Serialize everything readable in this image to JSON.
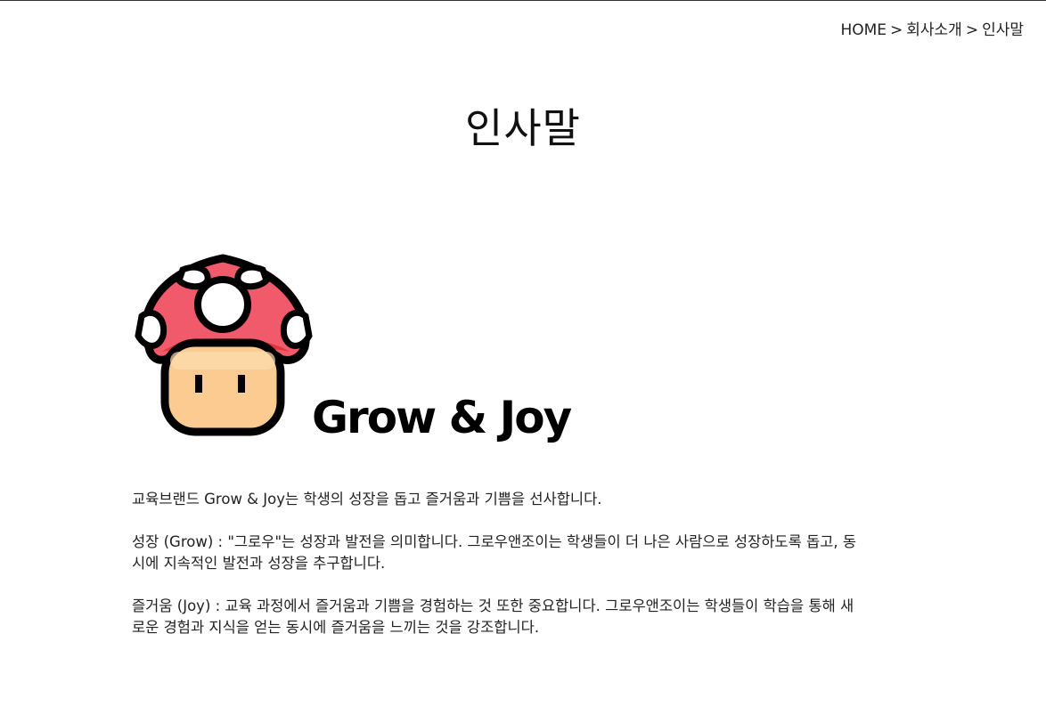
{
  "breadcrumb": {
    "home": "HOME",
    "separator": ">",
    "section": "회사소개",
    "current": "인사말"
  },
  "page": {
    "title": "인사말"
  },
  "logo": {
    "brand_text": "Grow & Joy",
    "icon": "mushroom-icon",
    "colors": {
      "cap": "#F05A6A",
      "cap_shadow": "#E2363F",
      "spots": "#FFFFFF",
      "face": "#FCCB92",
      "outline": "#000000"
    }
  },
  "content": {
    "intro": "교육브랜드 Grow & Joy는 학생의 성장을 돕고 즐거움과 기쁨을 선사합니다.",
    "grow": "성장 (Grow) : \"그로우\"는 성장과 발전을 의미합니다. 그로우앤조이는 학생들이 더 나은 사람으로 성장하도록 돕고, 동시에 지속적인 발전과 성장을 추구합니다.",
    "joy": "즐거움 (Joy) : 교육 과정에서 즐거움과 기쁨을 경험하는 것 또한 중요합니다. 그로우앤조이는 학생들이 학습을 통해 새로운 경험과 지식을 얻는 동시에 즐거움을 느끼는 것을 강조합니다."
  }
}
